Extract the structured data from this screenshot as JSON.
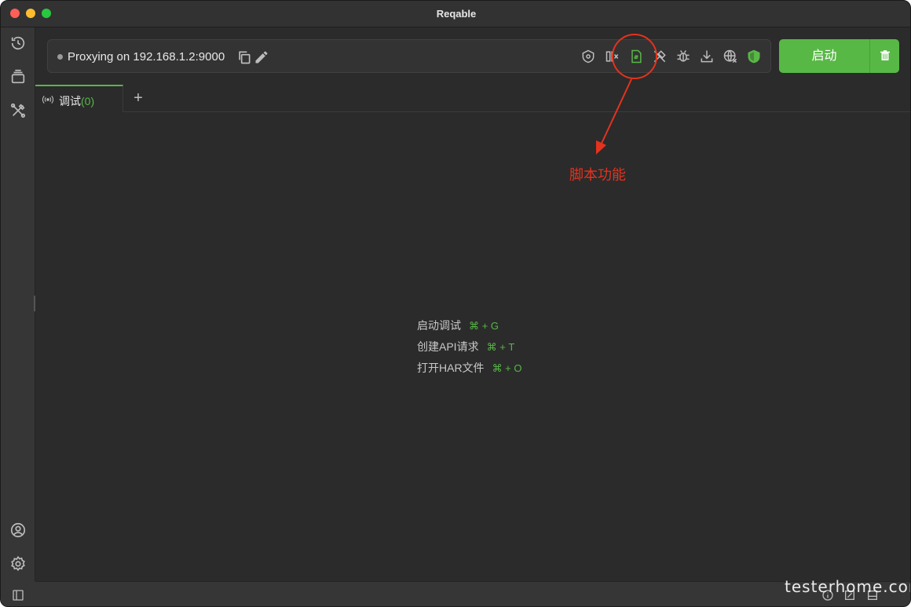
{
  "window": {
    "title": "Reqable"
  },
  "colors": {
    "accent": "#58b846",
    "annotation": "#e5321e",
    "background": "#2b2b2b"
  },
  "sidebar": {
    "items": [
      {
        "icon": "history-icon"
      },
      {
        "icon": "collections-icon"
      },
      {
        "icon": "tools-icon"
      }
    ],
    "bottom": [
      {
        "icon": "account-icon"
      },
      {
        "icon": "settings-icon"
      }
    ]
  },
  "proxy": {
    "status_text": "Proxying on 192.168.1.2:9000",
    "icons": [
      "copy-icon",
      "edit-icon",
      "ssl-proxy-icon",
      "mirror-icon",
      "script-icon",
      "rewrite-icon",
      "breakpoint-icon",
      "gateway-icon",
      "network-throttle-icon",
      "secure-certificate-icon"
    ]
  },
  "actions": {
    "start_label": "启动",
    "delete_icon": "trash-icon"
  },
  "tabs": [
    {
      "label": "调试",
      "count": "(0)",
      "icon": "broadcast-icon"
    }
  ],
  "tab_add": "+",
  "shortcuts": [
    {
      "label": "启动调试",
      "keys": "⌘ + G"
    },
    {
      "label": "创建API请求",
      "keys": "⌘ + T"
    },
    {
      "label": "打开HAR文件",
      "keys": "⌘ + O"
    }
  ],
  "annotation": {
    "text": "脚本功能"
  },
  "watermark": "testerhome.com"
}
